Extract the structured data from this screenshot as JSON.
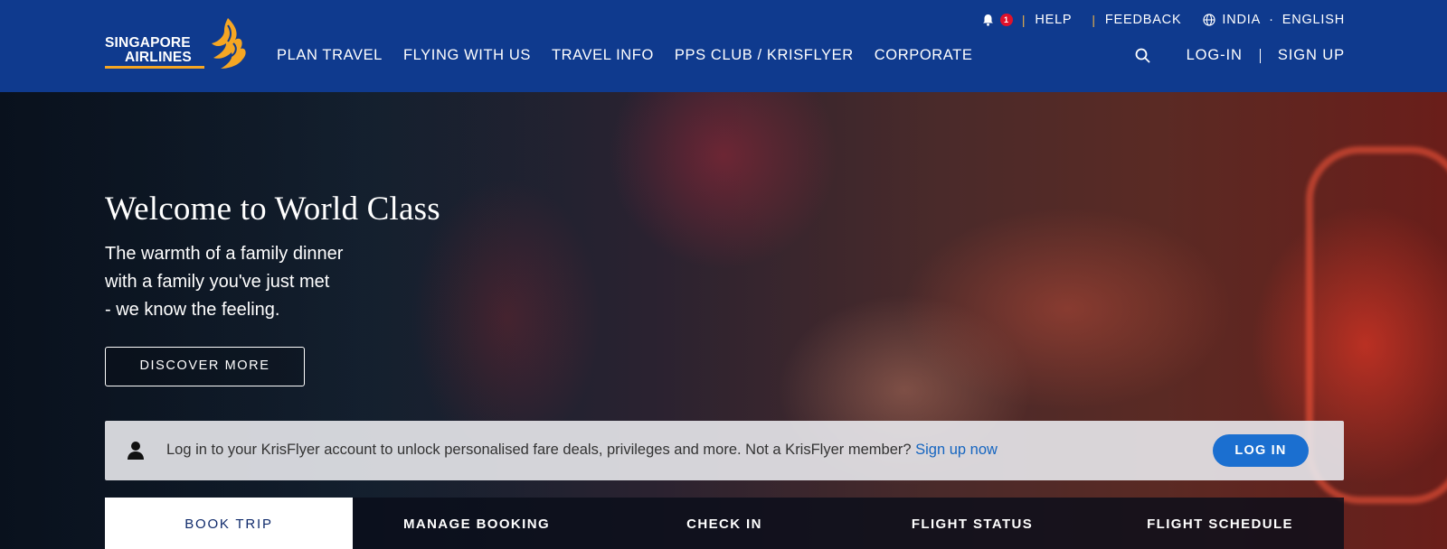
{
  "brand": {
    "line1": "SINGAPORE",
    "line2": "AIRLINES",
    "accent_color": "#f5a623",
    "header_bg": "#0f3a8e"
  },
  "utility": {
    "notification_count": "1",
    "help": "HELP",
    "feedback": "FEEDBACK",
    "country": "INDIA",
    "dot": "·",
    "language": "ENGLISH"
  },
  "nav": {
    "items": [
      {
        "label": "PLAN TRAVEL"
      },
      {
        "label": "FLYING WITH US"
      },
      {
        "label": "TRAVEL INFO"
      },
      {
        "label": "PPS CLUB / KRISFLYER"
      },
      {
        "label": "CORPORATE"
      }
    ],
    "login": "LOG-IN",
    "signup": "SIGN UP"
  },
  "hero": {
    "title": "Welcome to World Class",
    "subtitle_lines": [
      "The warmth of a family dinner",
      "with a family you've just met",
      "- we know the feeling."
    ],
    "cta": "DISCOVER MORE"
  },
  "login_bar": {
    "message": "Log in to your KrisFlyer account to unlock personalised fare deals, privileges and more. Not a KrisFlyer member? ",
    "signup_link": "Sign up now",
    "button": "LOG IN",
    "button_color": "#1b6fd0"
  },
  "tabs": [
    {
      "label": "BOOK TRIP",
      "active": true
    },
    {
      "label": "MANAGE BOOKING",
      "active": false
    },
    {
      "label": "CHECK IN",
      "active": false
    },
    {
      "label": "FLIGHT STATUS",
      "active": false
    },
    {
      "label": "FLIGHT SCHEDULE",
      "active": false
    }
  ]
}
